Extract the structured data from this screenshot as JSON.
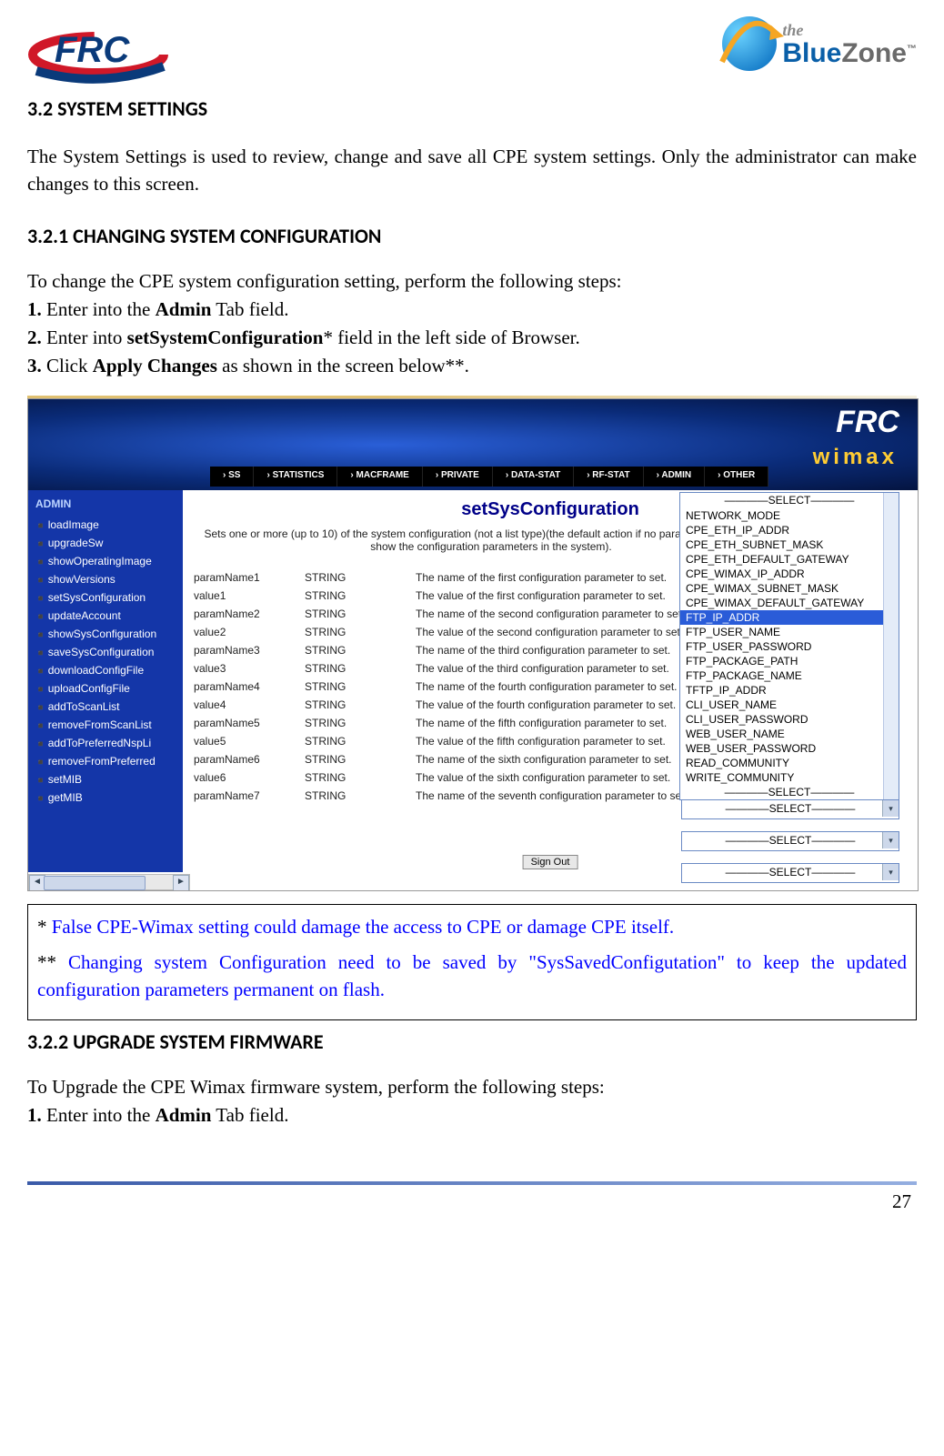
{
  "header": {
    "logo_left_text": "FRC",
    "logo_right_top": "the",
    "logo_right_main_a": "Blue",
    "logo_right_main_b": "Zone",
    "tm": "™"
  },
  "section_3_2": {
    "heading": "3.2 SYSTEM SETTINGS",
    "intro": "The System Settings is used to review, change and save all CPE system settings. Only the administrator can make changes to this screen."
  },
  "section_3_2_1": {
    "heading": "3.2.1 CHANGING SYSTEM CONFIGURATION",
    "intro": "To change the CPE system configuration setting, perform the following steps:",
    "step1_pre": "1. ",
    "step1_mid1": "Enter into the ",
    "step1_bold": "Admin",
    "step1_mid2": " Tab field.",
    "step2_pre": "2. ",
    "step2_mid1": "Enter into ",
    "step2_bold": "setSystemConfiguration",
    "step2_mid2": "* field in the left side of Browser.",
    "step3_pre": "3. ",
    "step3_mid1": "Click ",
    "step3_bold": "Apply Changes",
    "step3_mid2": " as shown in the screen below**."
  },
  "screenshot": {
    "frc": "FRC",
    "wimax": "wimax",
    "nav": [
      "SS",
      "STATISTICS",
      "MACFRAME",
      "PRIVATE",
      "DATA-STAT",
      "RF-STAT",
      "ADMIN",
      "OTHER"
    ],
    "sidebar_header": "ADMIN",
    "sidebar": [
      "loadImage",
      "upgradeSw",
      "showOperatingImage",
      "showVersions",
      "setSysConfiguration",
      "updateAccount",
      "showSysConfiguration",
      "saveSysConfiguration",
      "downloadConfigFile",
      "uploadConfigFile",
      "addToScanList",
      "removeFromScanList",
      "addToPreferredNspLi",
      "removeFromPreferred",
      "setMIB",
      "getMIB"
    ],
    "title": "setSysConfiguration",
    "desc": "Sets one or more (up to 10) of the system configuration (not a list type)(the default action if no parameter specified is to show the configuration parameters in the system).",
    "table": [
      {
        "p": "paramName1",
        "t": "STRING",
        "d": "The name of the first configuration parameter to set."
      },
      {
        "p": "value1",
        "t": "STRING",
        "d": "The value of the first configuration parameter to set."
      },
      {
        "p": "paramName2",
        "t": "STRING",
        "d": "The name of the second configuration parameter to set."
      },
      {
        "p": "value2",
        "t": "STRING",
        "d": "The value of the second configuration parameter to set."
      },
      {
        "p": "paramName3",
        "t": "STRING",
        "d": "The name of the third configuration parameter to set."
      },
      {
        "p": "value3",
        "t": "STRING",
        "d": "The value of the third configuration parameter to set."
      },
      {
        "p": "paramName4",
        "t": "STRING",
        "d": "The name of the fourth configuration parameter to set."
      },
      {
        "p": "value4",
        "t": "STRING",
        "d": "The value of the fourth configuration parameter to set."
      },
      {
        "p": "paramName5",
        "t": "STRING",
        "d": "The name of the fifth configuration parameter to set."
      },
      {
        "p": "value5",
        "t": "STRING",
        "d": "The value of the fifth configuration parameter to set."
      },
      {
        "p": "paramName6",
        "t": "STRING",
        "d": "The name of the sixth configuration parameter to set."
      },
      {
        "p": "value6",
        "t": "STRING",
        "d": "The value of the sixth configuration parameter to set."
      },
      {
        "p": "paramName7",
        "t": "STRING",
        "d": "The name of the seventh configuration parameter to set."
      }
    ],
    "dropdown_top": "————SELECT————",
    "dropdown": [
      "NETWORK_MODE",
      "CPE_ETH_IP_ADDR",
      "CPE_ETH_SUBNET_MASK",
      "CPE_ETH_DEFAULT_GATEWAY",
      "CPE_WIMAX_IP_ADDR",
      "CPE_WIMAX_SUBNET_MASK",
      "CPE_WIMAX_DEFAULT_GATEWAY",
      "FTP_IP_ADDR",
      "FTP_USER_NAME",
      "FTP_USER_PASSWORD",
      "FTP_PACKAGE_PATH",
      "FTP_PACKAGE_NAME",
      "TFTP_IP_ADDR",
      "CLI_USER_NAME",
      "CLI_USER_PASSWORD",
      "WEB_USER_NAME",
      "WEB_USER_PASSWORD",
      "READ_COMMUNITY",
      "WRITE_COMMUNITY"
    ],
    "dropdown_selected_index": 7,
    "dropdown_end": "————SELECT————",
    "select_placeholder": "————SELECT————",
    "signout": "Sign Out"
  },
  "notebox": {
    "line1_pre": "* ",
    "line1_blue": "False CPE-Wimax setting could damage the access to CPE or damage CPE itself.",
    "line2_pre": "** ",
    "line2_blue": "Changing system Configuration need to be saved by \"SysSavedConfigutation\" to keep the updated configuration parameters permanent on flash."
  },
  "section_3_2_2": {
    "heading": "3.2.2 UPGRADE SYSTEM FIRMWARE",
    "intro": "To Upgrade the CPE Wimax firmware system, perform the following steps:",
    "step1_pre": "1. ",
    "step1_mid1": "Enter into the ",
    "step1_bold": "Admin",
    "step1_mid2": " Tab field."
  },
  "page_number": "27"
}
